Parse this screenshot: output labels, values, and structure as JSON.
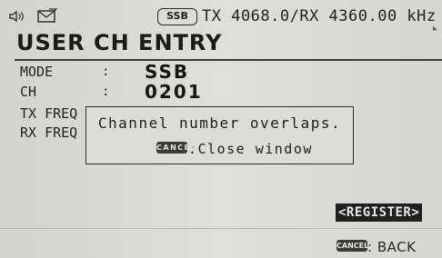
{
  "status_bar": {
    "speaker_icon": "speaker-icon",
    "mail_icon": "mail-icon",
    "mode_badge": "SSB",
    "frequency": "TX 4068.0/RX 4360.00 kHz"
  },
  "screen": {
    "title": "USER CH ENTRY"
  },
  "fields": {
    "mode": {
      "label": "MODE",
      "colon": ":",
      "value": "SSB"
    },
    "channel": {
      "label": "CH",
      "colon": ":",
      "value": "0201"
    },
    "tx_freq": {
      "label": "TX FREQ"
    },
    "rx_freq": {
      "label": "RX FREQ"
    }
  },
  "dialog": {
    "message": "Channel number overlaps.",
    "key_label": "CANCEL",
    "action_text": ":Close window"
  },
  "footer": {
    "register_label": "<REGISTER>",
    "back_key_label": "CANCEL",
    "back_text": ": BACK"
  },
  "colors": {
    "lcd_background": "#dcdcd8",
    "text": "#1d1d1d",
    "highlight": "#1f1f1f"
  }
}
